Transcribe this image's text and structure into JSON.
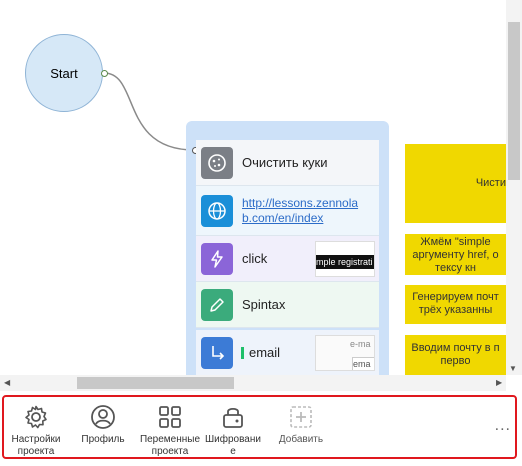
{
  "canvas": {
    "start_node": {
      "label": "Start"
    },
    "actions": [
      {
        "label": "Очистить куки",
        "icon": "cookie-icon",
        "color": "#7b7f86"
      },
      {
        "label": "http://lessons.zennolab.com/en/index",
        "icon": "globe-icon",
        "color": "#1a8fd8"
      },
      {
        "label": "click",
        "icon": "lightning-icon",
        "color": "#8b65d8",
        "thumb_text": "mple registrati"
      },
      {
        "label": "Spintax",
        "icon": "pencil-icon",
        "color": "#3bab7c"
      },
      {
        "label": "email",
        "icon": "arrow-down-right-icon",
        "color": "#3c7bd6",
        "thumb_text_top": "e-ma",
        "thumb_text_bottom": "ema"
      }
    ],
    "notes": [
      {
        "text": "Чисти"
      },
      {
        "line1": "Жмём \"simple",
        "line2": "аргументу href, о",
        "line3": "тексу кн"
      },
      {
        "line1": "Генерируем почт",
        "line2": "трёх указанны"
      },
      {
        "line1": "Вводим почту в п",
        "line2": "перво"
      }
    ]
  },
  "toolbar": {
    "items": [
      {
        "label_line1": "Настройки",
        "label_line2": "проекта",
        "icon": "gear-icon"
      },
      {
        "label_line1": "Профиль",
        "label_line2": "",
        "icon": "user-icon"
      },
      {
        "label_line1": "Переменные",
        "label_line2": "проекта",
        "icon": "grid-icon"
      },
      {
        "label_line1": "Шифровани",
        "label_line2": "е",
        "icon": "lock-icon"
      },
      {
        "label_line1": "Добавить",
        "label_line2": "",
        "icon": "add-icon"
      }
    ],
    "more": "..."
  },
  "colors": {
    "accent_border": "#e0181e",
    "note_bg": "#f0d800",
    "group_bg": "#cde1f8",
    "start_bg": "#d6e8f7"
  }
}
